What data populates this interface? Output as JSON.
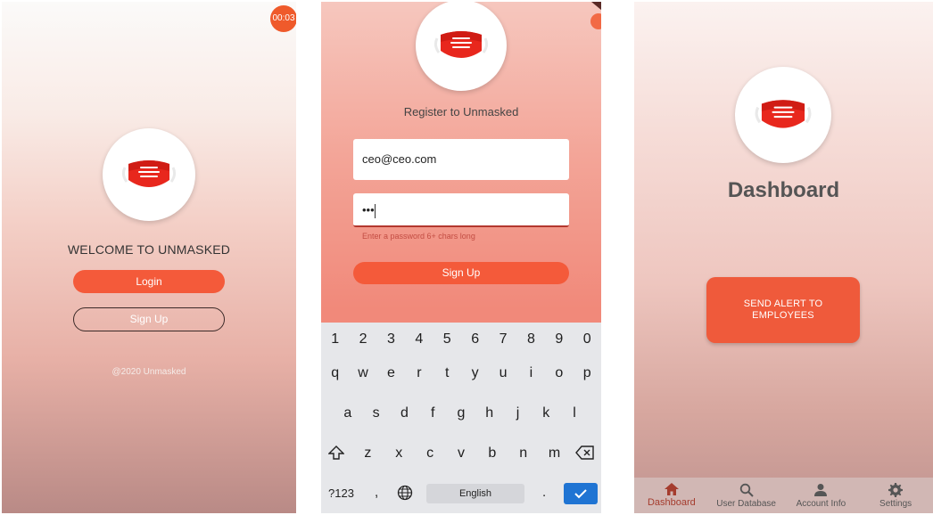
{
  "colors": {
    "accent": "#f45a3a",
    "nav_active": "#a53c2e",
    "enter_key": "#1f74d3"
  },
  "screen1": {
    "timer": "00:03",
    "welcome": "WELCOME TO UNMASKED",
    "login_label": "Login",
    "signup_label": "Sign Up",
    "copyright": "@2020 Unmasked"
  },
  "screen2": {
    "title": "Register to Unmasked",
    "email_value": "ceo@ceo.com",
    "password_value": "•••",
    "password_hint": "Enter a password 6+ chars long",
    "signup_label": "Sign Up",
    "keyboard": {
      "row1": [
        "1",
        "2",
        "3",
        "4",
        "5",
        "6",
        "7",
        "8",
        "9",
        "0"
      ],
      "row2": [
        "q",
        "w",
        "e",
        "r",
        "t",
        "y",
        "u",
        "i",
        "o",
        "p"
      ],
      "row3": [
        "a",
        "s",
        "d",
        "f",
        "g",
        "h",
        "j",
        "k",
        "l"
      ],
      "row4": [
        "z",
        "x",
        "c",
        "v",
        "b",
        "n",
        "m"
      ],
      "symbols_label": "?123",
      "comma": ",",
      "space_label": "English",
      "period": "."
    }
  },
  "screen3": {
    "title": "Dashboard",
    "alert_button": "SEND ALERT TO EMPLOYEES",
    "nav": [
      {
        "label": "Dashboard",
        "icon": "home-icon"
      },
      {
        "label": "User Database",
        "icon": "search-icon"
      },
      {
        "label": "Account Info",
        "icon": "person-icon"
      },
      {
        "label": "Settings",
        "icon": "gear-icon"
      }
    ]
  }
}
